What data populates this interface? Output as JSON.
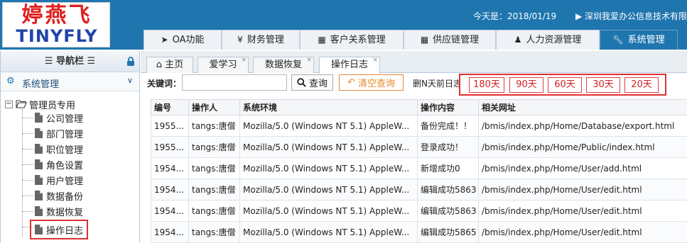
{
  "brand": {
    "logo_cn": "婷燕飞",
    "logo_en": "TINYFLY"
  },
  "header": {
    "date_text": "今天是：2018/01/19",
    "company_text": "▶ 深圳我爱办公信息技术有限"
  },
  "top_tabs": [
    {
      "label": "OA功能",
      "icon": "send-icon"
    },
    {
      "label": "财务管理",
      "icon": "yen-icon"
    },
    {
      "label": "客户关系管理",
      "icon": "table-icon"
    },
    {
      "label": "供应链管理",
      "icon": "table-icon"
    },
    {
      "label": "人力资源管理",
      "icon": "user-icon"
    },
    {
      "label": "系统管理",
      "icon": "wrench-icon",
      "active": true
    }
  ],
  "sidebar": {
    "title": "☰ 导航栏 ☰",
    "section": "系统管理",
    "tree_root": "管理员专用",
    "items": [
      {
        "label": "公司管理"
      },
      {
        "label": "部门管理"
      },
      {
        "label": "职位管理"
      },
      {
        "label": "角色设置"
      },
      {
        "label": "用户管理"
      },
      {
        "label": "数据备份"
      },
      {
        "label": "数据恢复"
      },
      {
        "label": "操作日志",
        "selected": true
      }
    ]
  },
  "sub_tabs": [
    {
      "label": "主页",
      "icon": "home-icon"
    },
    {
      "label": "爱学习",
      "closable": true
    },
    {
      "label": "数据恢复",
      "closable": true
    },
    {
      "label": "操作日志",
      "closable": true,
      "active": true
    }
  ],
  "search": {
    "keyword_label": "关键词：",
    "keyword_value": "",
    "search_button": "查询",
    "clear_button": "清空查询",
    "delete_label": "删N天前日志:",
    "day_buttons": [
      "180天",
      "90天",
      "60天",
      "30天",
      "20天"
    ]
  },
  "table": {
    "columns": [
      "编号",
      "操作人",
      "系统环境",
      "操作内容",
      "相关网址"
    ],
    "rows": [
      [
        "1955...",
        "tangs:唐僧",
        "Mozilla/5.0 (Windows NT 5.1) AppleW...",
        "备份完成！！",
        "/bmis/index.php/Home/Database/export.html"
      ],
      [
        "1955...",
        "tangs:唐僧",
        "Mozilla/5.0 (Windows NT 5.1) AppleW...",
        "登录成功！",
        "/bmis/index.php/Home/Public/index.html"
      ],
      [
        "1954...",
        "tangs:唐僧",
        "Mozilla/5.0 (Windows NT 5.1) AppleW...",
        "新增成功0",
        "/bmis/index.php/Home/User/add.html"
      ],
      [
        "1954...",
        "tangs:唐僧",
        "Mozilla/5.0 (Windows NT 5.1) AppleW...",
        "编辑成功5863",
        "/bmis/index.php/Home/User/edit.html"
      ],
      [
        "1954...",
        "tangs:唐僧",
        "Mozilla/5.0 (Windows NT 5.1) AppleW...",
        "编辑成功5863",
        "/bmis/index.php/Home/User/edit.html"
      ],
      [
        "1954...",
        "tangs:唐僧",
        "Mozilla/5.0 (Windows NT 5.1) AppleW...",
        "编辑成功5865",
        "/bmis/index.php/Home/User/edit.html"
      ]
    ]
  },
  "colors": {
    "header_blue": "#1f75ae",
    "highlight_red": "#e03030",
    "clear_orange": "#e8882a"
  }
}
